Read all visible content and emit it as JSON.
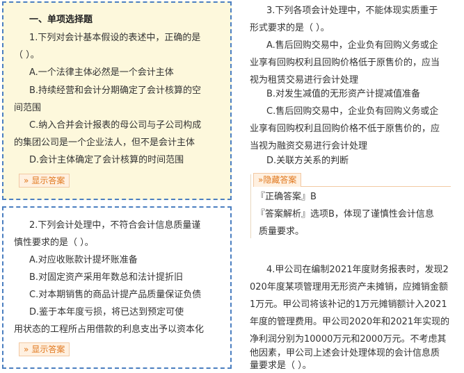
{
  "section_title": "一、单项选择题",
  "questions": [
    {
      "lines": [
        "1.下列对会计基本假设的表述中，正确的是",
        "（ ）。"
      ],
      "options": [
        [
          "A.一个法律主体必然是一个会计主体"
        ],
        [
          "B.持续经营和会计分期确定了会计核算的空",
          "间范围"
        ],
        [
          "C.纳入合并会计报表的母公司与子公司构成",
          "的集团公司是一个企业法人，但不是会计主体"
        ],
        [
          "D.会计主体确定了会计核算的时间范围"
        ]
      ],
      "button": "显示答案"
    },
    {
      "lines": [
        "2.下列会计处理中，不符合会计信息质量谨",
        "慎性要求的是（ ）。"
      ],
      "options": [
        [
          "A.对应收账款计提坏账准备"
        ],
        [
          "B.对固定资产采用年数总和法计提折旧"
        ],
        [
          "C.对本期销售的商品计提产品质量保证负债"
        ],
        [
          "D.鉴于本年度亏损，将已达到预定可使",
          "用状态的工程所占用借款的利息支出予以资本化"
        ]
      ],
      "button": "显示答案"
    },
    {
      "lines": [
        "3.下列各项会计处理中，不能体现实质重于",
        "形式要求的是（ ）。"
      ],
      "options": [
        [
          "A.售后回购交易中，企业负有回购义务或企",
          "业享有回购权利且回购价格低于原售价的，应当",
          "视为租赁交易进行会计处理"
        ],
        [
          "B.对发生减值的无形资产计提减值准备"
        ],
        [
          "C.售后回购交易中，企业负有回购义务或企",
          "业享有回购权利且回购价格不低于原售价的，应",
          "当视为融资交易进行会计处理"
        ],
        [
          "D.关联方关系的判断"
        ]
      ],
      "answer_panel": {
        "tab": "隐藏答案",
        "answer": "『正确答案』B",
        "analysis": [
          "『答案解析』选项B，体现了谨慎性会计信息",
          "质量要求。"
        ]
      }
    },
    {
      "lines": [
        "4.甲公司在编制2021年度财务报表时，发现2",
        "020年度某项管理用无形资产未摊销，应摊销金额",
        "1万元。甲公司将该补记的1万元摊销额计入2021",
        "年度的管理费用。甲公司2020年和2021年实现的",
        "净利润分别为10000万元和2000万元。不考虑其",
        "他因素，甲公司上述会计处理体现的会计信息质",
        "量要求是（ ）。"
      ]
    }
  ]
}
